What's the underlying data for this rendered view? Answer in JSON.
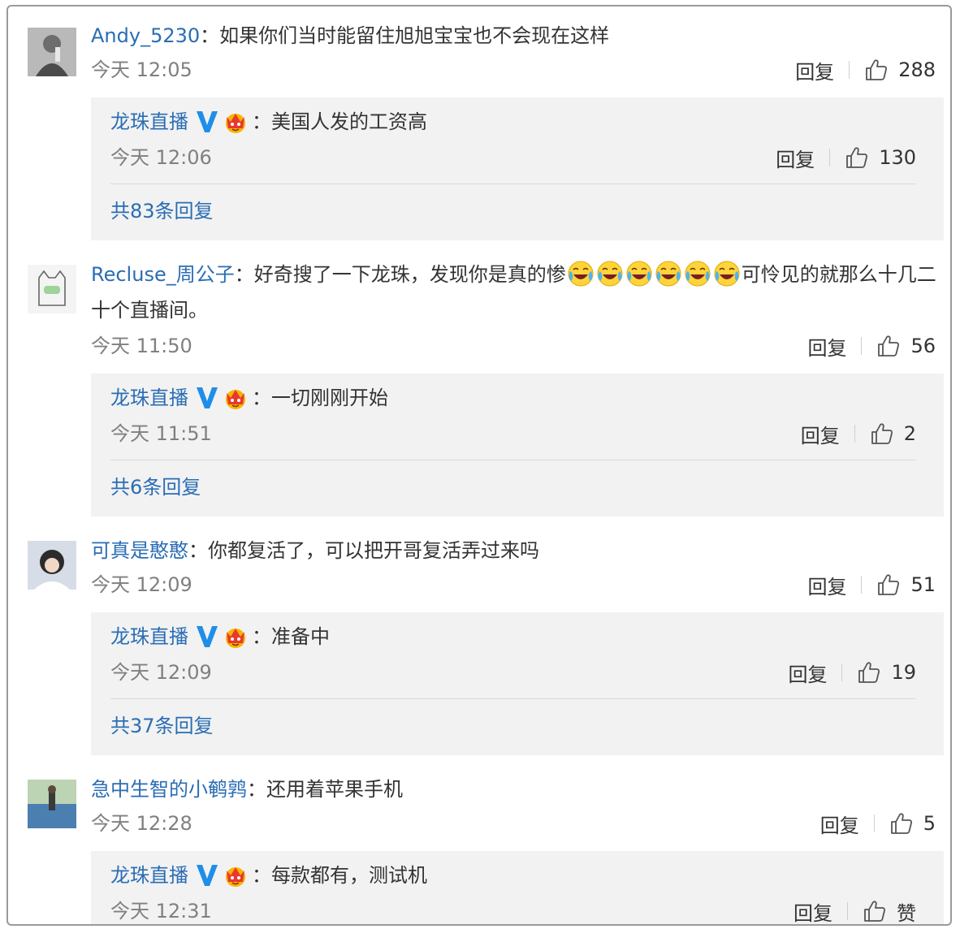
{
  "comments": [
    {
      "user": "Andy_5230",
      "sep": "：",
      "text": "如果你们当时能留住旭旭宝宝也不会现在这样",
      "time": "今天 12:05",
      "reply_label": "回复",
      "likes": "288",
      "reply": {
        "user": "龙珠直播",
        "sep": "：",
        "text": "美国人发的工资高",
        "time": "今天 12:06",
        "reply_label": "回复",
        "likes": "130",
        "more": "共83条回复"
      }
    },
    {
      "user": "Recluse_周公子",
      "sep": "：",
      "text_before": "好奇搜了一下龙珠，发现你是真的惨",
      "emoji_count": 6,
      "emoji_icon": "laugh-cry-emoji",
      "text_after": "可怜见的就那么十几二",
      "text_line2": "十个直播间。",
      "time": "今天 11:50",
      "reply_label": "回复",
      "likes": "56",
      "reply": {
        "user": "龙珠直播",
        "sep": "：",
        "text": "一切刚刚开始",
        "time": "今天 11:51",
        "reply_label": "回复",
        "likes": "2",
        "more": "共6条回复"
      }
    },
    {
      "user": "可真是憨憨",
      "sep": "：",
      "text": "你都复活了，可以把开哥复活弄过来吗",
      "time": "今天 12:09",
      "reply_label": "回复",
      "likes": "51",
      "reply": {
        "user": "龙珠直播",
        "sep": "：",
        "text": "准备中",
        "time": "今天 12:09",
        "reply_label": "回复",
        "likes": "19",
        "more": "共37条回复"
      }
    },
    {
      "user": "急中生智的小鹌鹑",
      "sep": "：",
      "text": "还用着苹果手机",
      "time": "今天 12:28",
      "reply_label": "回复",
      "likes": "5",
      "reply": {
        "user": "龙珠直播",
        "sep": "：",
        "text": "每款都有，测试机",
        "time": "今天 12:31",
        "reply_label": "回复",
        "likes": "赞"
      }
    }
  ],
  "icons": {
    "verified": "verified-v-icon",
    "crown": "crown-badge-icon",
    "like": "thumbs-up-icon"
  },
  "colors": {
    "username": "#2a6db4",
    "verified": "#1f8ee8",
    "reply_bg": "#f2f2f2",
    "meta_text": "#808080"
  }
}
